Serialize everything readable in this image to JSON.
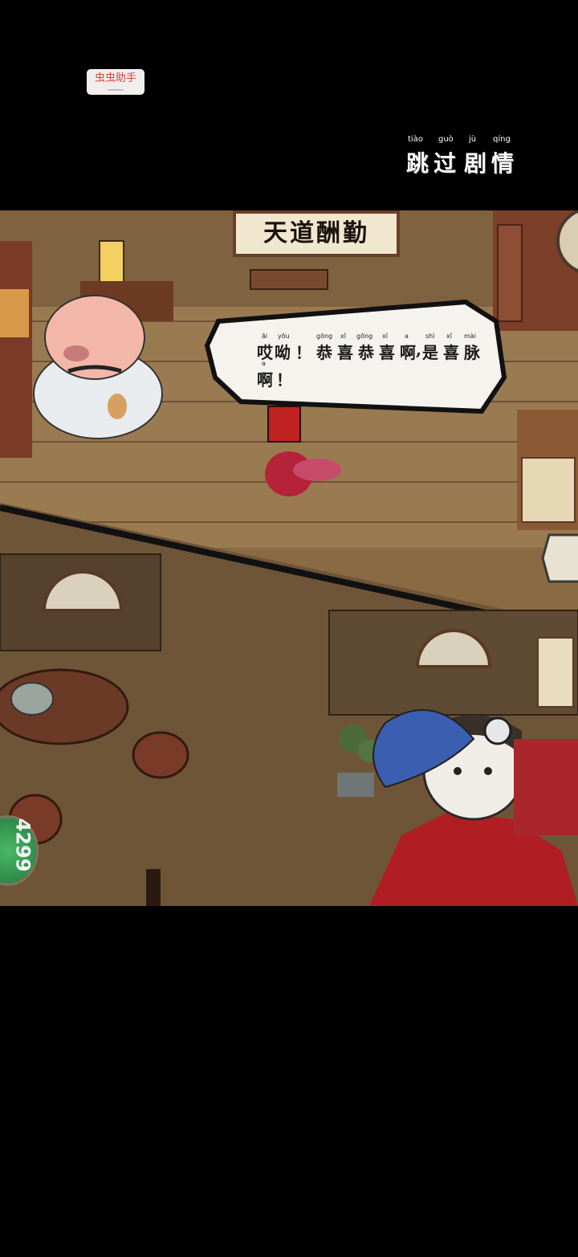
{
  "overlay": {
    "helper_label": "虫虫助手"
  },
  "skip_button": {
    "pinyin": [
      "tiào",
      "guò",
      "jù",
      "qíng"
    ],
    "hanzi": [
      "跳",
      "过",
      "剧",
      "情"
    ]
  },
  "scene": {
    "plaque_text": "天道酬勤"
  },
  "dialogue": {
    "line1": [
      {
        "py": "āi",
        "hz": "哎"
      },
      {
        "py": "yōu",
        "hz": "呦"
      },
      {
        "py": "",
        "hz": "！"
      },
      {
        "py": "gōng",
        "hz": "恭"
      },
      {
        "py": "xǐ",
        "hz": "喜"
      },
      {
        "py": "gōng",
        "hz": "恭"
      },
      {
        "py": "xǐ",
        "hz": "喜"
      },
      {
        "py": "a",
        "hz": "啊"
      },
      {
        "py": "",
        "hz": ","
      },
      {
        "py": "shì",
        "hz": "是"
      },
      {
        "py": "xǐ",
        "hz": "喜"
      },
      {
        "py": "mài",
        "hz": "脉"
      }
    ],
    "line2": [
      {
        "py": "a",
        "hz": "啊"
      },
      {
        "py": "",
        "hz": "！"
      }
    ]
  },
  "hud": {
    "score": "4299"
  }
}
